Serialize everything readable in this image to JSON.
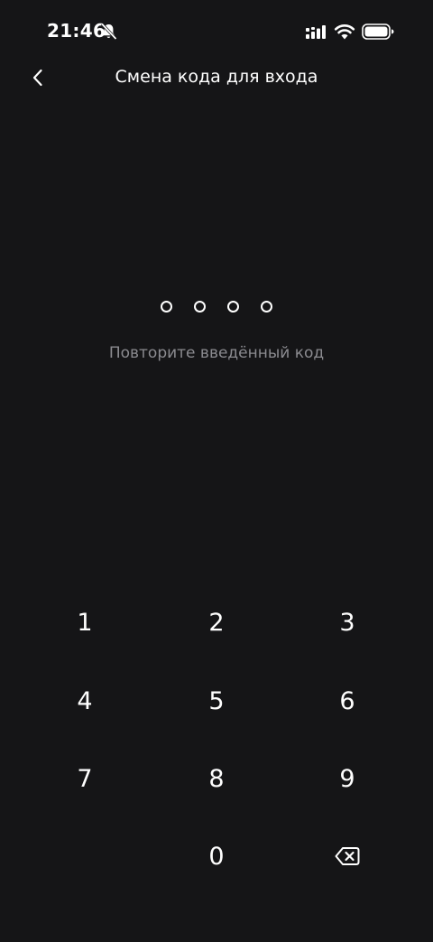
{
  "status_bar": {
    "time": "21:46",
    "icons": [
      "bell-muted-icon",
      "signal-icon",
      "wifi-icon",
      "battery-icon"
    ]
  },
  "header": {
    "title": "Смена кода для входа",
    "back_icon": "chevron-left-icon"
  },
  "pin": {
    "length": 4,
    "filled": 0,
    "hint": "Повторите введённый код"
  },
  "keypad": {
    "keys": [
      "1",
      "2",
      "3",
      "4",
      "5",
      "6",
      "7",
      "8",
      "9",
      "0"
    ],
    "backspace_icon": "backspace-icon"
  },
  "colors": {
    "background": "#151517",
    "text_primary": "#ffffff",
    "text_secondary": "#8b8b90"
  }
}
